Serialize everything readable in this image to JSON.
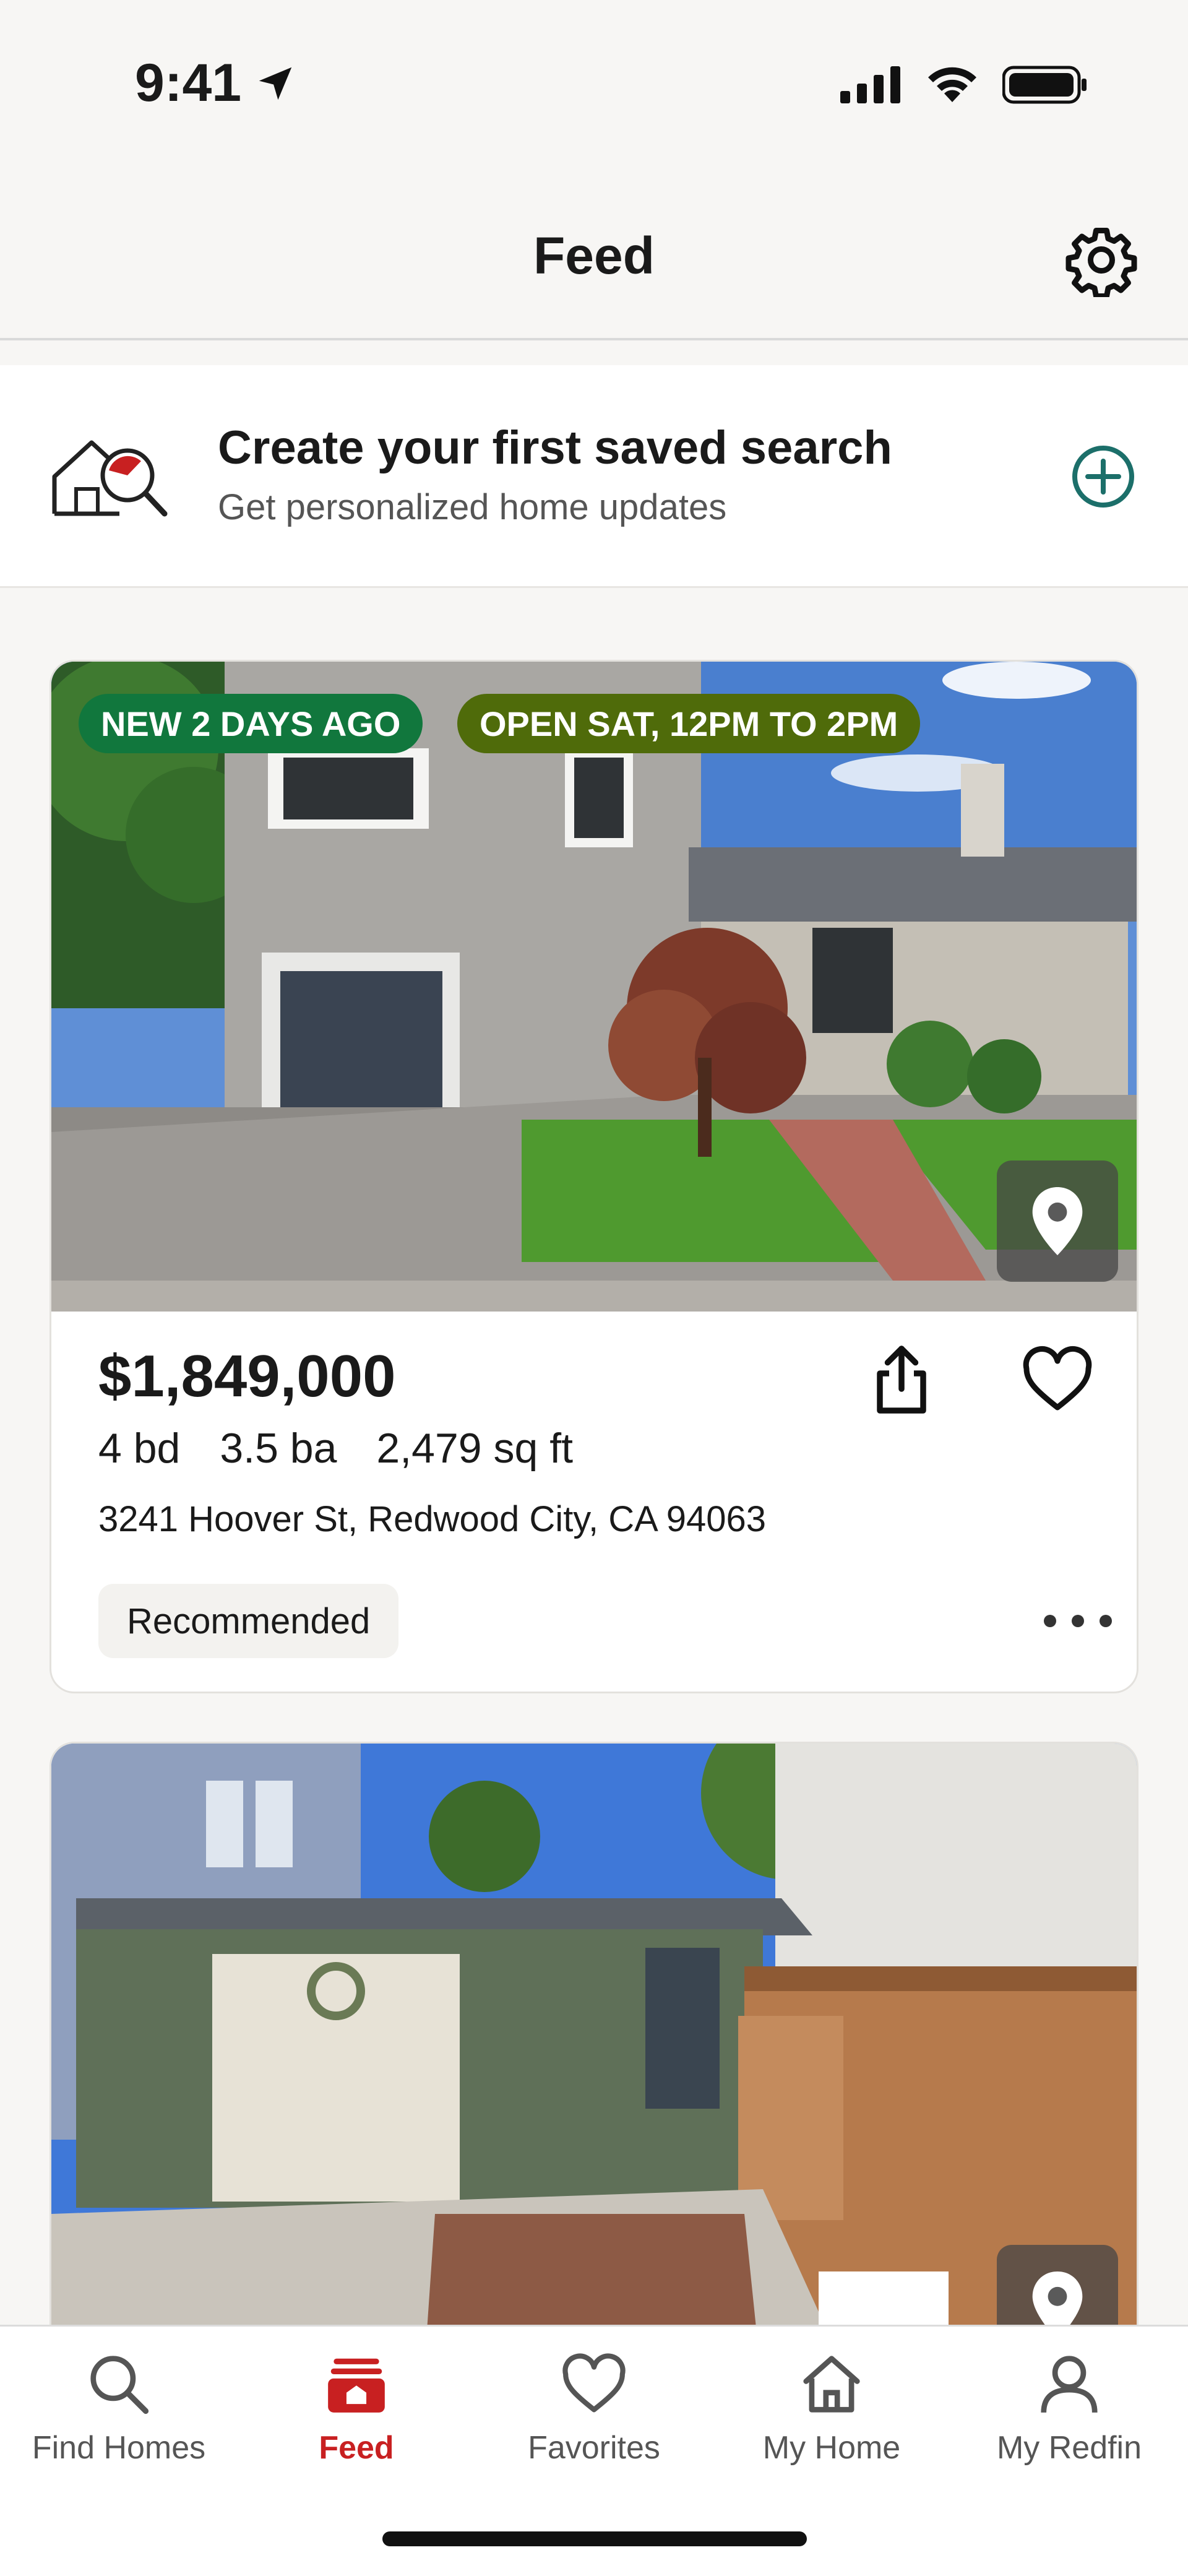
{
  "status_bar": {
    "time": "9:41"
  },
  "header": {
    "title": "Feed"
  },
  "saved_search": {
    "title": "Create your first saved search",
    "subtitle": "Get personalized home updates"
  },
  "listings": [
    {
      "badges": [
        "NEW 2 DAYS AGO",
        "OPEN SAT, 12PM TO 2PM"
      ],
      "price": "$1,849,000",
      "beds": "4 bd",
      "baths": "3.5 ba",
      "sqft": "2,479 sq ft",
      "address": "3241 Hoover St, Redwood City, CA 94063",
      "tag": "Recommended"
    },
    {
      "badges": [],
      "price": "",
      "address": ""
    }
  ],
  "bottom_nav": {
    "items": [
      {
        "label": "Find Homes",
        "icon": "search-icon"
      },
      {
        "label": "Feed",
        "icon": "feed-icon",
        "active": true
      },
      {
        "label": "Favorites",
        "icon": "heart-icon"
      },
      {
        "label": "My Home",
        "icon": "home-icon"
      },
      {
        "label": "My Redfin",
        "icon": "person-icon"
      }
    ]
  },
  "colors": {
    "accent_red": "#c82021",
    "badge_new": "#11773d",
    "badge_open": "#4f6b0a",
    "teal": "#1c6f6a"
  }
}
